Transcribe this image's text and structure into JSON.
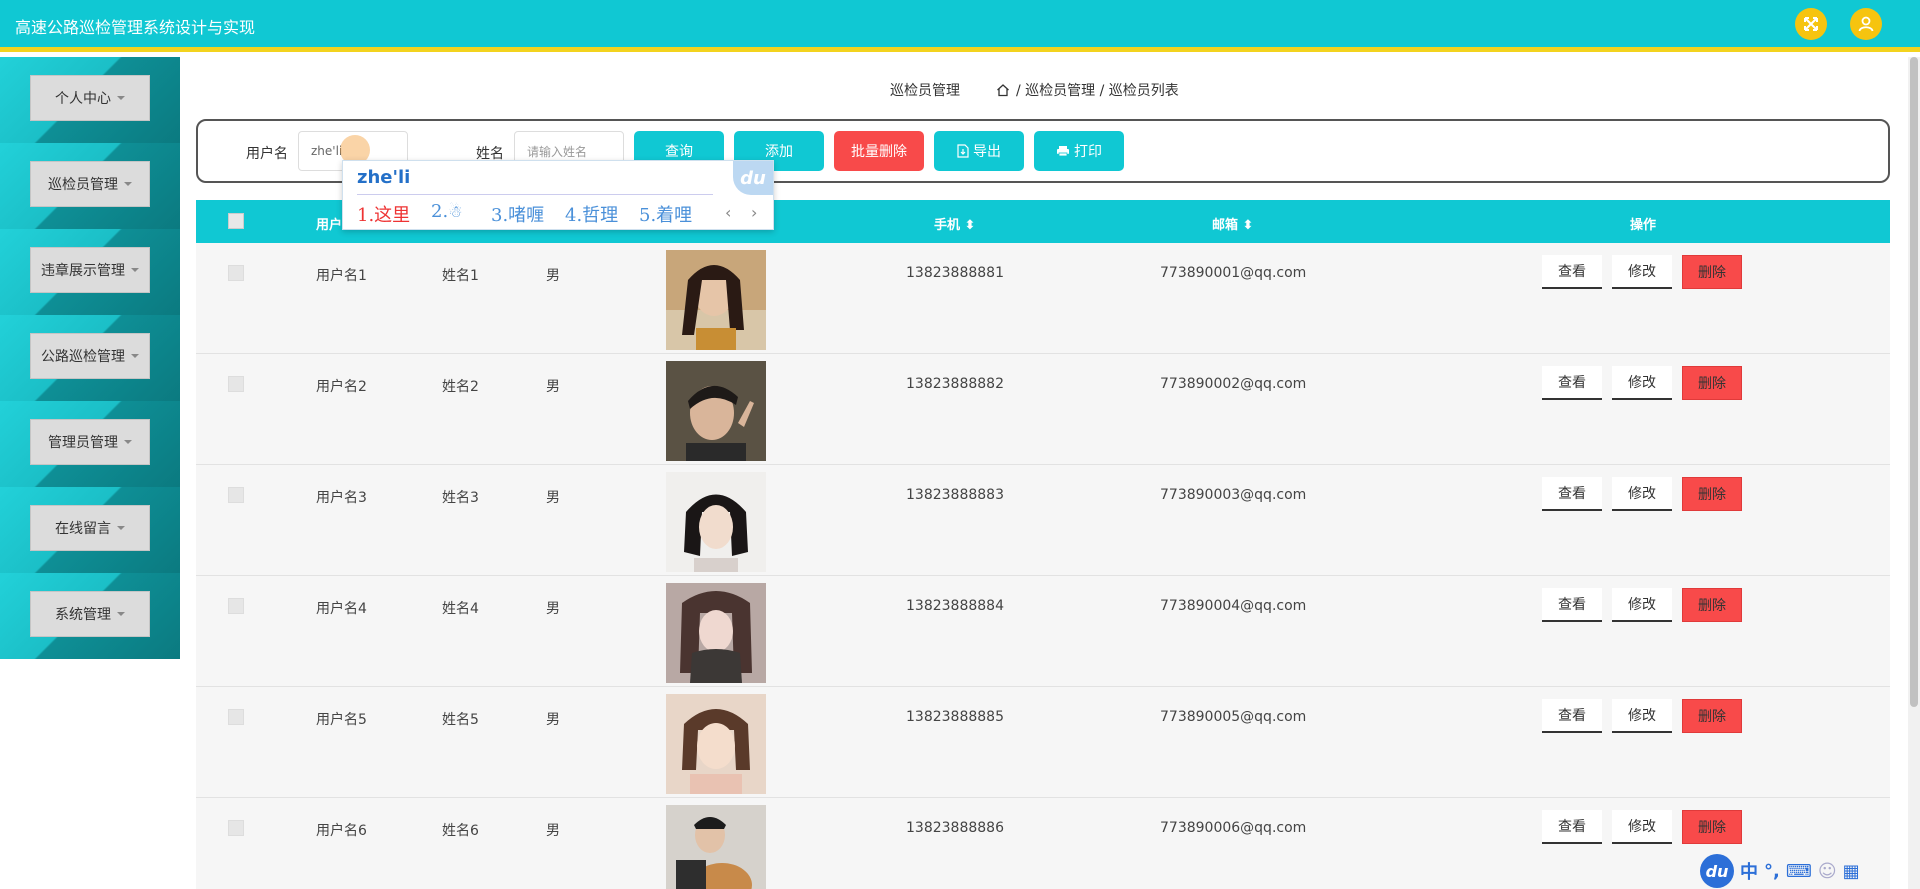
{
  "app": {
    "title": "高速公路巡检管理系统设计与实现"
  },
  "header": {
    "icons": [
      "expand-icon",
      "user-icon"
    ]
  },
  "sidebar": {
    "items": [
      {
        "label": "个人中心"
      },
      {
        "label": "巡检员管理"
      },
      {
        "label": "违章展示管理"
      },
      {
        "label": "公路巡检管理"
      },
      {
        "label": "管理员管理"
      },
      {
        "label": "在线留言"
      },
      {
        "label": "系统管理"
      }
    ]
  },
  "breadcrumb": {
    "title": "巡检员管理",
    "path": "/ 巡检员管理 / 巡检员列表"
  },
  "search": {
    "username_label": "用户名",
    "username_value": "zhe'li",
    "name_label": "姓名",
    "name_placeholder": "请输入姓名",
    "query": "查询",
    "add": "添加",
    "batch_delete": "批量删除",
    "export": "导出",
    "print": "打印"
  },
  "ime": {
    "composition": "zhe'li",
    "candidates": [
      "1.这里",
      "2.",
      "3.啫喱",
      "4.哲理",
      "5.着哩"
    ],
    "logo": "du"
  },
  "table": {
    "headers": {
      "username": "用户",
      "phone": "手机",
      "email": "邮箱",
      "actions": "操作"
    },
    "action_labels": {
      "view": "查看",
      "edit": "修改",
      "delete": "删除"
    },
    "rows": [
      {
        "username": "用户名1",
        "name": "姓名1",
        "gender": "男",
        "phone": "13823888881",
        "email": "773890001@qq.com"
      },
      {
        "username": "用户名2",
        "name": "姓名2",
        "gender": "男",
        "phone": "13823888882",
        "email": "773890002@qq.com"
      },
      {
        "username": "用户名3",
        "name": "姓名3",
        "gender": "男",
        "phone": "13823888883",
        "email": "773890003@qq.com"
      },
      {
        "username": "用户名4",
        "name": "姓名4",
        "gender": "男",
        "phone": "13823888884",
        "email": "773890004@qq.com"
      },
      {
        "username": "用户名5",
        "name": "姓名5",
        "gender": "男",
        "phone": "13823888885",
        "email": "773890005@qq.com"
      },
      {
        "username": "用户名6",
        "name": "姓名6",
        "gender": "男",
        "phone": "13823888886",
        "email": "773890006@qq.com"
      }
    ]
  },
  "taskbar": {
    "ime_logo": "du",
    "ime_mode": "中"
  },
  "colors": {
    "primary": "#10c8d3",
    "accent": "#f3d31e",
    "danger": "#f84a4a"
  }
}
